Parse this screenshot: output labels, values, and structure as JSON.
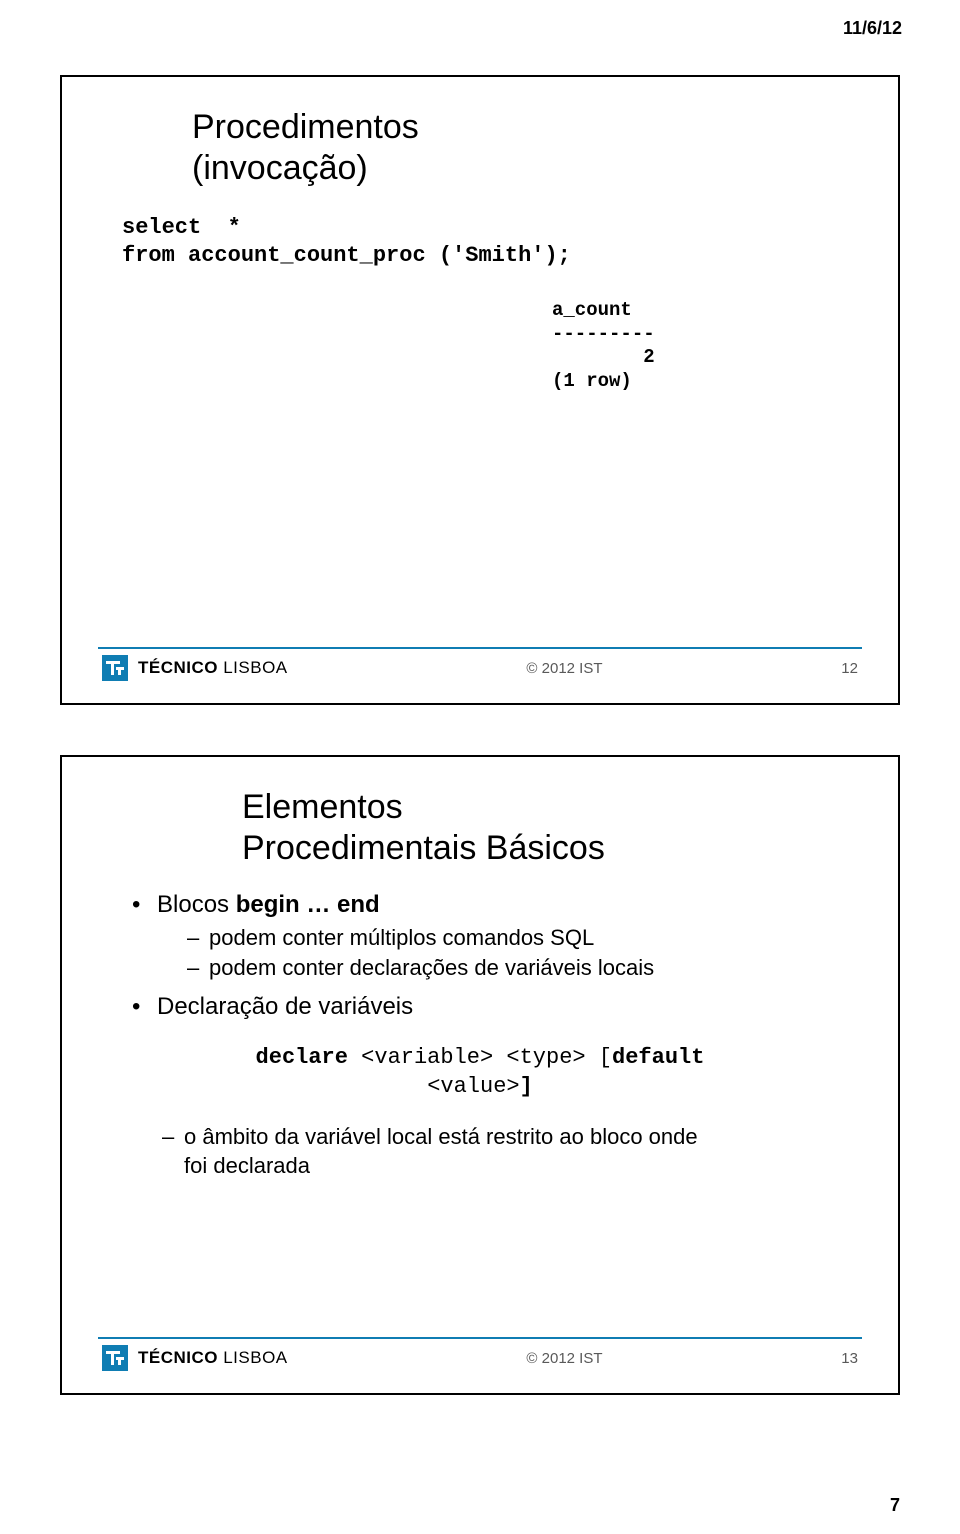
{
  "header": {
    "date": "11/6/12"
  },
  "slide1": {
    "title_l1": "Procedimentos",
    "title_l2": "(invocação)",
    "code_l1": "select  *",
    "code_l2": "from account_count_proc ('Smith');",
    "result_l1": "a_count",
    "result_l2": "---------",
    "result_l3": "        2",
    "result_l4": "(1 row)",
    "brand1": "TÉCNICO",
    "brand2": " LISBOA",
    "copyright": "© 2012 IST",
    "num": "12"
  },
  "slide2": {
    "title_l1": "Elementos",
    "title_l2": "Procedimentais Básicos",
    "b1_pre": "Blocos ",
    "b1_bold": "begin … end",
    "b1_sub1": "podem conter múltiplos comandos SQL",
    "b1_sub2": "podem conter declarações de variáveis locais",
    "b2": "Declaração de variáveis",
    "decl_l1_a": "declare ",
    "decl_l1_b": "<variable> <type> [",
    "decl_l1_c": "default",
    "decl_l2_a": "<value>",
    "decl_l2_b": "]",
    "b3_sub1_l1": "o âmbito da variável local está restrito ao bloco onde",
    "b3_sub1_l2": "foi declarada",
    "brand1": "TÉCNICO",
    "brand2": " LISBOA",
    "copyright": "© 2012 IST",
    "num": "13"
  },
  "footer": {
    "pagenum": "7"
  }
}
